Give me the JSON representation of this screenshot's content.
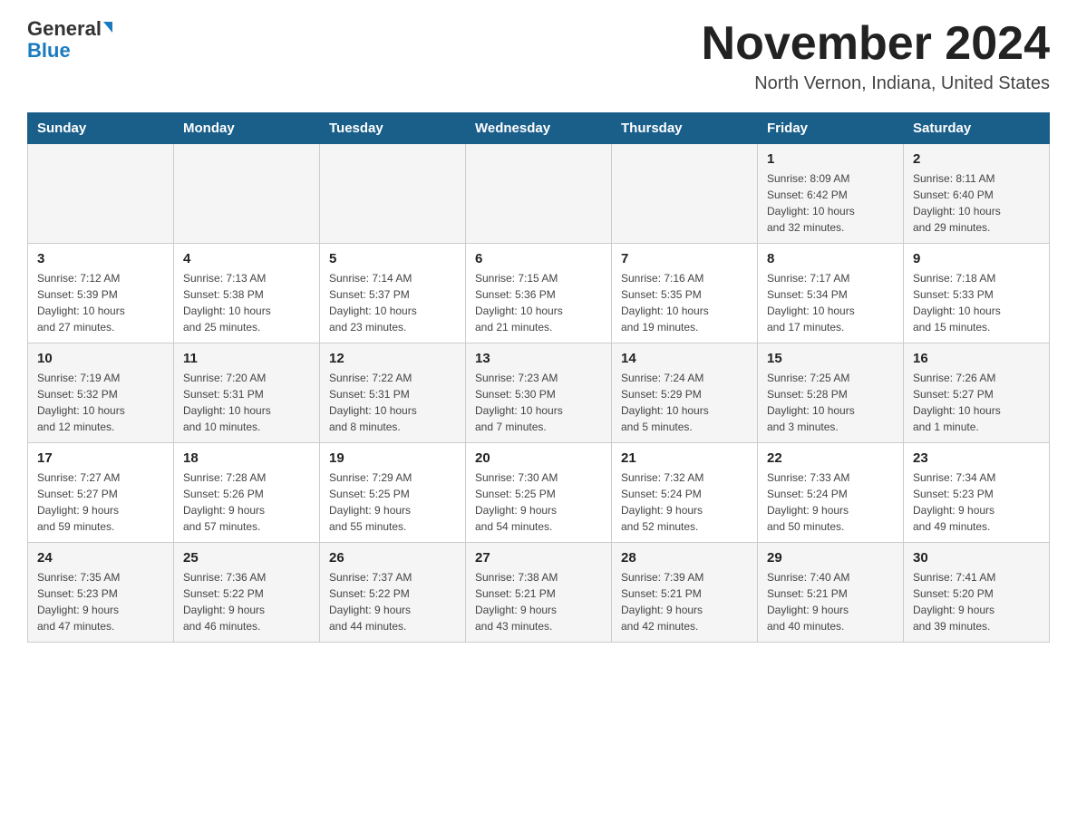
{
  "header": {
    "logo_general": "General",
    "logo_blue": "Blue",
    "month_title": "November 2024",
    "location": "North Vernon, Indiana, United States"
  },
  "days_of_week": [
    "Sunday",
    "Monday",
    "Tuesday",
    "Wednesday",
    "Thursday",
    "Friday",
    "Saturday"
  ],
  "weeks": [
    {
      "days": [
        {
          "number": "",
          "info": ""
        },
        {
          "number": "",
          "info": ""
        },
        {
          "number": "",
          "info": ""
        },
        {
          "number": "",
          "info": ""
        },
        {
          "number": "",
          "info": ""
        },
        {
          "number": "1",
          "info": "Sunrise: 8:09 AM\nSunset: 6:42 PM\nDaylight: 10 hours\nand 32 minutes."
        },
        {
          "number": "2",
          "info": "Sunrise: 8:11 AM\nSunset: 6:40 PM\nDaylight: 10 hours\nand 29 minutes."
        }
      ]
    },
    {
      "days": [
        {
          "number": "3",
          "info": "Sunrise: 7:12 AM\nSunset: 5:39 PM\nDaylight: 10 hours\nand 27 minutes."
        },
        {
          "number": "4",
          "info": "Sunrise: 7:13 AM\nSunset: 5:38 PM\nDaylight: 10 hours\nand 25 minutes."
        },
        {
          "number": "5",
          "info": "Sunrise: 7:14 AM\nSunset: 5:37 PM\nDaylight: 10 hours\nand 23 minutes."
        },
        {
          "number": "6",
          "info": "Sunrise: 7:15 AM\nSunset: 5:36 PM\nDaylight: 10 hours\nand 21 minutes."
        },
        {
          "number": "7",
          "info": "Sunrise: 7:16 AM\nSunset: 5:35 PM\nDaylight: 10 hours\nand 19 minutes."
        },
        {
          "number": "8",
          "info": "Sunrise: 7:17 AM\nSunset: 5:34 PM\nDaylight: 10 hours\nand 17 minutes."
        },
        {
          "number": "9",
          "info": "Sunrise: 7:18 AM\nSunset: 5:33 PM\nDaylight: 10 hours\nand 15 minutes."
        }
      ]
    },
    {
      "days": [
        {
          "number": "10",
          "info": "Sunrise: 7:19 AM\nSunset: 5:32 PM\nDaylight: 10 hours\nand 12 minutes."
        },
        {
          "number": "11",
          "info": "Sunrise: 7:20 AM\nSunset: 5:31 PM\nDaylight: 10 hours\nand 10 minutes."
        },
        {
          "number": "12",
          "info": "Sunrise: 7:22 AM\nSunset: 5:31 PM\nDaylight: 10 hours\nand 8 minutes."
        },
        {
          "number": "13",
          "info": "Sunrise: 7:23 AM\nSunset: 5:30 PM\nDaylight: 10 hours\nand 7 minutes."
        },
        {
          "number": "14",
          "info": "Sunrise: 7:24 AM\nSunset: 5:29 PM\nDaylight: 10 hours\nand 5 minutes."
        },
        {
          "number": "15",
          "info": "Sunrise: 7:25 AM\nSunset: 5:28 PM\nDaylight: 10 hours\nand 3 minutes."
        },
        {
          "number": "16",
          "info": "Sunrise: 7:26 AM\nSunset: 5:27 PM\nDaylight: 10 hours\nand 1 minute."
        }
      ]
    },
    {
      "days": [
        {
          "number": "17",
          "info": "Sunrise: 7:27 AM\nSunset: 5:27 PM\nDaylight: 9 hours\nand 59 minutes."
        },
        {
          "number": "18",
          "info": "Sunrise: 7:28 AM\nSunset: 5:26 PM\nDaylight: 9 hours\nand 57 minutes."
        },
        {
          "number": "19",
          "info": "Sunrise: 7:29 AM\nSunset: 5:25 PM\nDaylight: 9 hours\nand 55 minutes."
        },
        {
          "number": "20",
          "info": "Sunrise: 7:30 AM\nSunset: 5:25 PM\nDaylight: 9 hours\nand 54 minutes."
        },
        {
          "number": "21",
          "info": "Sunrise: 7:32 AM\nSunset: 5:24 PM\nDaylight: 9 hours\nand 52 minutes."
        },
        {
          "number": "22",
          "info": "Sunrise: 7:33 AM\nSunset: 5:24 PM\nDaylight: 9 hours\nand 50 minutes."
        },
        {
          "number": "23",
          "info": "Sunrise: 7:34 AM\nSunset: 5:23 PM\nDaylight: 9 hours\nand 49 minutes."
        }
      ]
    },
    {
      "days": [
        {
          "number": "24",
          "info": "Sunrise: 7:35 AM\nSunset: 5:23 PM\nDaylight: 9 hours\nand 47 minutes."
        },
        {
          "number": "25",
          "info": "Sunrise: 7:36 AM\nSunset: 5:22 PM\nDaylight: 9 hours\nand 46 minutes."
        },
        {
          "number": "26",
          "info": "Sunrise: 7:37 AM\nSunset: 5:22 PM\nDaylight: 9 hours\nand 44 minutes."
        },
        {
          "number": "27",
          "info": "Sunrise: 7:38 AM\nSunset: 5:21 PM\nDaylight: 9 hours\nand 43 minutes."
        },
        {
          "number": "28",
          "info": "Sunrise: 7:39 AM\nSunset: 5:21 PM\nDaylight: 9 hours\nand 42 minutes."
        },
        {
          "number": "29",
          "info": "Sunrise: 7:40 AM\nSunset: 5:21 PM\nDaylight: 9 hours\nand 40 minutes."
        },
        {
          "number": "30",
          "info": "Sunrise: 7:41 AM\nSunset: 5:20 PM\nDaylight: 9 hours\nand 39 minutes."
        }
      ]
    }
  ]
}
